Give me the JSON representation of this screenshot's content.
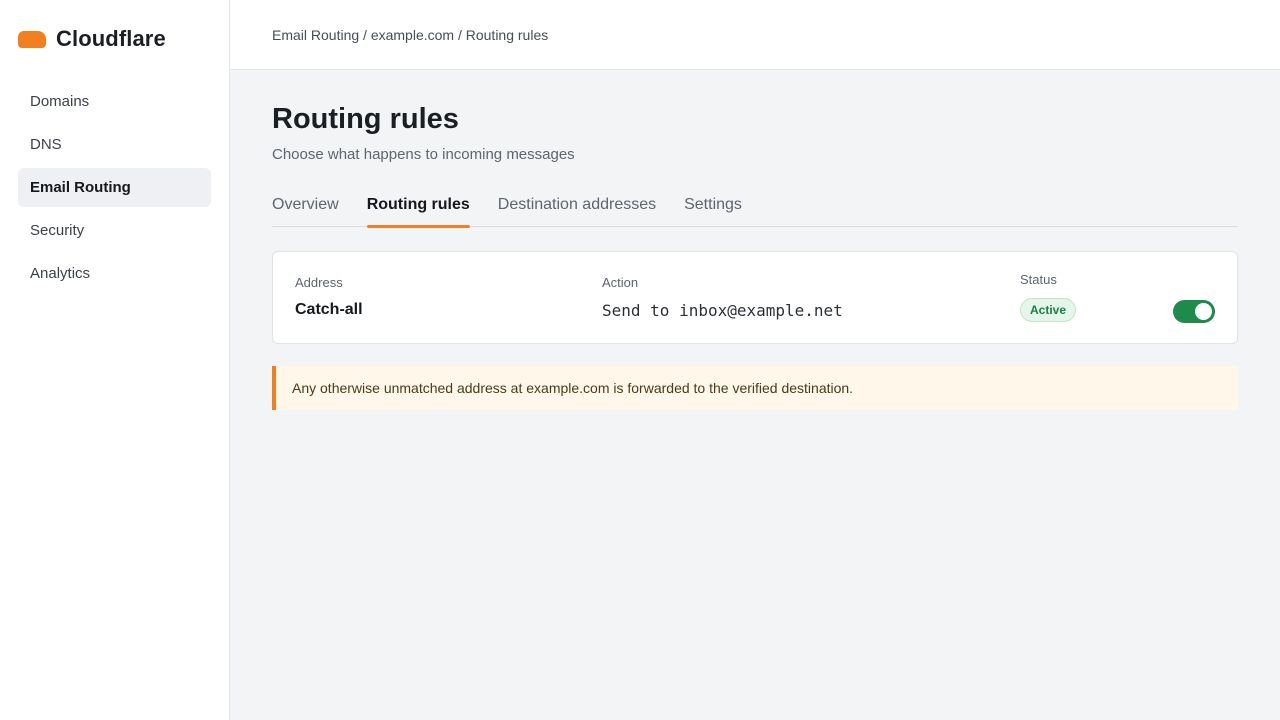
{
  "brand": {
    "name": "Cloudflare",
    "logo_color": "#f38020"
  },
  "sidebar": {
    "items": [
      {
        "label": "Domains"
      },
      {
        "label": "DNS"
      },
      {
        "label": "Email Routing",
        "active": true
      },
      {
        "label": "Security"
      },
      {
        "label": "Analytics"
      }
    ]
  },
  "breadcrumb": {
    "text": "Email Routing / example.com / Routing rules"
  },
  "page": {
    "title": "Routing rules",
    "subtitle": "Choose what happens to incoming messages"
  },
  "tabs": [
    {
      "label": "Overview"
    },
    {
      "label": "Routing rules",
      "active": true
    },
    {
      "label": "Destination addresses"
    },
    {
      "label": "Settings"
    }
  ],
  "rule": {
    "address_label": "Address",
    "address_value": "Catch-all",
    "action_label": "Action",
    "action_value": "Send to inbox@example.net",
    "status_label": "Status",
    "status_value": "Active",
    "enabled": true
  },
  "notice": {
    "text": "Any otherwise unmatched address at example.com is forwarded to the verified destination."
  },
  "colors": {
    "accent": "#f38020",
    "toggle_on": "#1e8a4c",
    "status_active": "#1a7f45"
  }
}
